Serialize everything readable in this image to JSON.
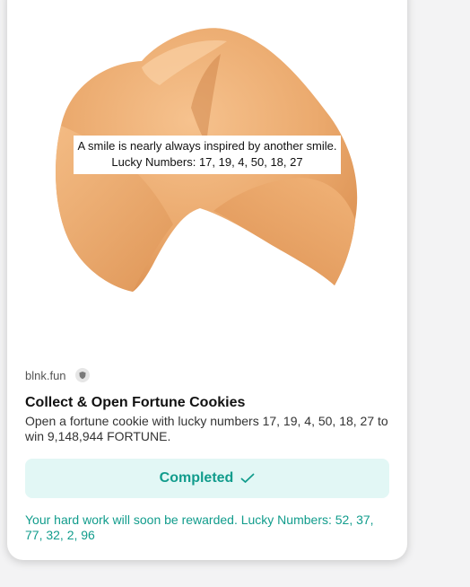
{
  "image": {
    "fortune_line1": "A smile is nearly always inspired by another smile.",
    "fortune_line2": "Lucky Numbers: 17, 19, 4, 50, 18, 27"
  },
  "meta": {
    "domain": "blnk.fun",
    "icon": "shield-icon"
  },
  "title": "Collect & Open Fortune Cookies",
  "description": "Open a fortune cookie with lucky numbers 17, 19, 4, 50, 18, 27 to win 9,148,944 FORTUNE.",
  "action": {
    "label": "Completed",
    "icon": "checkmark-icon",
    "accent_color": "#119c8c",
    "background_color": "#e2f7f5"
  },
  "reward_message": "Your hard work will soon be rewarded. Lucky Numbers: 52, 37, 77, 32, 2, 96"
}
